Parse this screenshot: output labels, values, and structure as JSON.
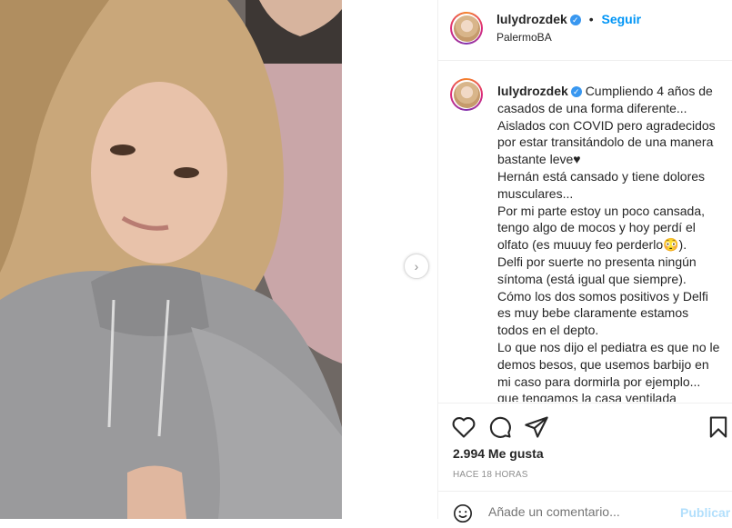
{
  "post": {
    "username": "lulydrozdek",
    "separator": "•",
    "follow_label": "Seguir",
    "location": "PalermoBA",
    "caption_lines": [
      "Cumpliendo 4 años de casados de una forma diferente...",
      "Aislados con COVID pero agradecidos por estar transitándolo de una manera bastante leve♥",
      "Hernán está cansado y tiene dolores musculares...",
      "Por mi parte estoy un poco cansada, tengo algo de mocos y hoy perdí el olfato (es muuuy feo perderlo😳).",
      "Delfi por suerte no presenta ningún síntoma (está igual que siempre).",
      "Cómo los dos somos positivos y Delfi es muy bebe claramente estamos todos en el depto.",
      "Lo que nos dijo el pediatra es que no le demos besos, que usemos barbijo en mi caso para dormirla por ejemplo... que tengamos la casa ventilada constantemente y que"
    ],
    "likes": "2.994 Me gusta",
    "time": "HACE 18 HORAS",
    "comment_placeholder": "Añade un comentario...",
    "publish_label": "Publicar"
  },
  "icons": {
    "verified": "verified-badge-icon",
    "next": "chevron-right-icon",
    "like": "heart-icon",
    "comment": "comment-bubble-icon",
    "share": "paper-plane-icon",
    "save": "bookmark-icon",
    "emoji": "emoji-smile-icon"
  },
  "colors": {
    "accent": "#0095f6",
    "verified": "#3897f0",
    "publish_disabled": "#b2dffc"
  }
}
